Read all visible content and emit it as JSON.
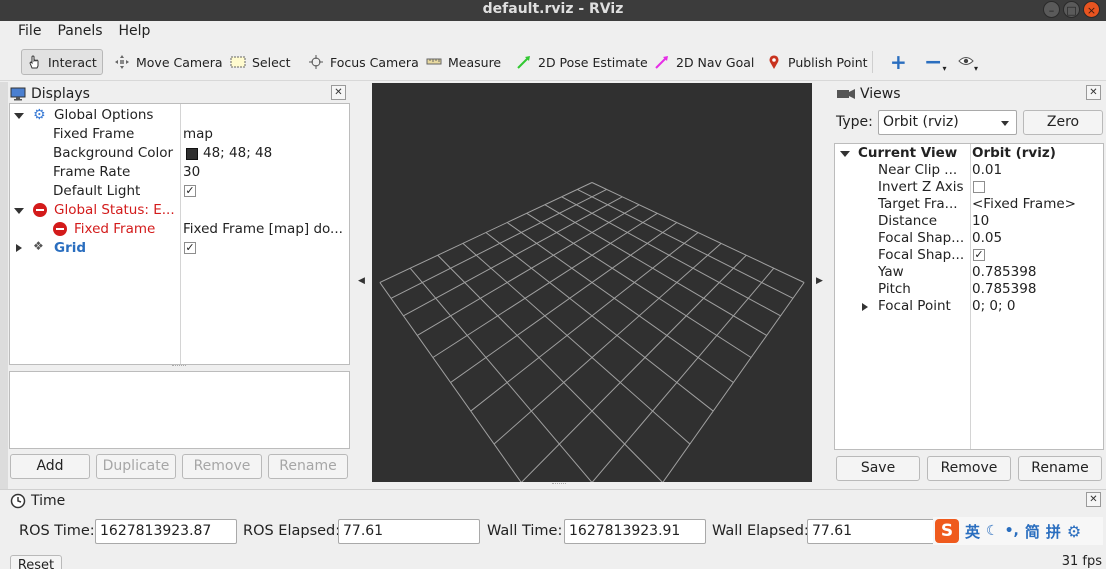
{
  "window": {
    "title": "default.rviz - RViz"
  },
  "menu": {
    "items": [
      "File",
      "Panels",
      "Help"
    ]
  },
  "toolbar": {
    "tools": [
      {
        "label": "Interact",
        "icon": "hand-icon"
      },
      {
        "label": "Move Camera",
        "icon": "move-camera-icon"
      },
      {
        "label": "Select",
        "icon": "select-icon"
      },
      {
        "label": "Focus Camera",
        "icon": "focus-camera-icon"
      },
      {
        "label": "Measure",
        "icon": "ruler-icon"
      },
      {
        "label": "2D Pose Estimate",
        "icon": "green-arrow-icon"
      },
      {
        "label": "2D Nav Goal",
        "icon": "magenta-arrow-icon"
      },
      {
        "label": "Publish Point",
        "icon": "map-pin-icon"
      }
    ]
  },
  "displays": {
    "title": "Displays",
    "rows": [
      {
        "name": "Global Options",
        "value": ""
      },
      {
        "name": "Fixed Frame",
        "value": "map"
      },
      {
        "name": "Background Color",
        "value": "48; 48; 48"
      },
      {
        "name": "Frame Rate",
        "value": "30"
      },
      {
        "name": "Default Light",
        "value": "✓"
      },
      {
        "name": "Global Status: E...",
        "value": ""
      },
      {
        "name": "Fixed Frame",
        "value": "Fixed Frame [map] do..."
      },
      {
        "name": "Grid",
        "value": "✓"
      }
    ],
    "buttons": {
      "add": "Add",
      "duplicate": "Duplicate",
      "remove": "Remove",
      "rename": "Rename"
    }
  },
  "views": {
    "title": "Views",
    "type_label": "Type:",
    "type_value": "Orbit (rviz)",
    "zero": "Zero",
    "rows": [
      {
        "name": "Current View",
        "value": "Orbit (rviz)"
      },
      {
        "name": "Near Clip ...",
        "value": "0.01"
      },
      {
        "name": "Invert Z Axis",
        "value": ""
      },
      {
        "name": "Target Fra...",
        "value": "<Fixed Frame>"
      },
      {
        "name": "Distance",
        "value": "10"
      },
      {
        "name": "Focal Shap...",
        "value": "0.05"
      },
      {
        "name": "Focal Shap...",
        "value": "✓"
      },
      {
        "name": "Yaw",
        "value": "0.785398"
      },
      {
        "name": "Pitch",
        "value": "0.785398"
      },
      {
        "name": "Focal Point",
        "value": "0; 0; 0"
      }
    ],
    "buttons": {
      "save": "Save",
      "remove": "Remove",
      "rename": "Rename"
    }
  },
  "time": {
    "title": "Time",
    "ros_time_label": "ROS Time:",
    "ros_time": "1627813923.87",
    "ros_elapsed_label": "ROS Elapsed:",
    "ros_elapsed": "77.61",
    "wall_time_label": "Wall Time:",
    "wall_time": "1627813923.91",
    "wall_elapsed_label": "Wall Elapsed:",
    "wall_elapsed": "77.61",
    "reset": "Reset",
    "fps": "31 fps"
  },
  "ime": {
    "items": [
      "英",
      "简",
      "拼"
    ]
  },
  "colors": {
    "background_swatch": "#303030",
    "error": "#d31b1b",
    "link_blue": "#2a6ebf"
  }
}
